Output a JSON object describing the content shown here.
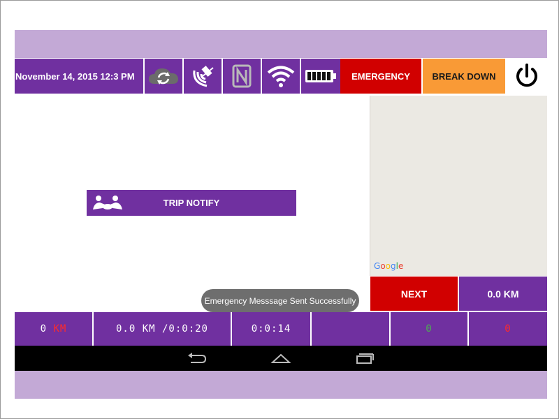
{
  "status_bar": {
    "datetime": "November 14, 2015 12:3 PM",
    "icons": [
      "sync-cloud-icon",
      "gps-signal-icon",
      "nfc-icon",
      "wifi-icon",
      "battery-icon"
    ],
    "emergency_label": "EMERGENCY",
    "breakdown_label": "BREAK DOWN",
    "power_icon": "power-icon"
  },
  "map": {
    "attribution_letters": [
      "G",
      "o",
      "o",
      "g",
      "l",
      "e"
    ]
  },
  "trip_notify": {
    "label": "TRIP NOTIFY",
    "icon": "handshake-icon"
  },
  "toast": {
    "message": "Emergency Messsage Sent Successfully"
  },
  "right_panel": {
    "next_label": "NEXT",
    "distance": "0.0 KM"
  },
  "info_bar": {
    "cell1_value": "0",
    "cell1_unit": "KM",
    "cell2": "0.0 KM /0:0:20",
    "cell3": "0:0:14",
    "cell4": "",
    "cell5": "0",
    "cell6": "0"
  },
  "nav_bar": {
    "buttons": [
      "back-icon",
      "home-icon",
      "recents-icon"
    ]
  },
  "colors": {
    "purple": "#7030a0",
    "band": "#c3a9d6",
    "emergency_red": "#d10000",
    "breakdown_orange": "#f99a36",
    "map_bg": "#ebe9e3"
  }
}
